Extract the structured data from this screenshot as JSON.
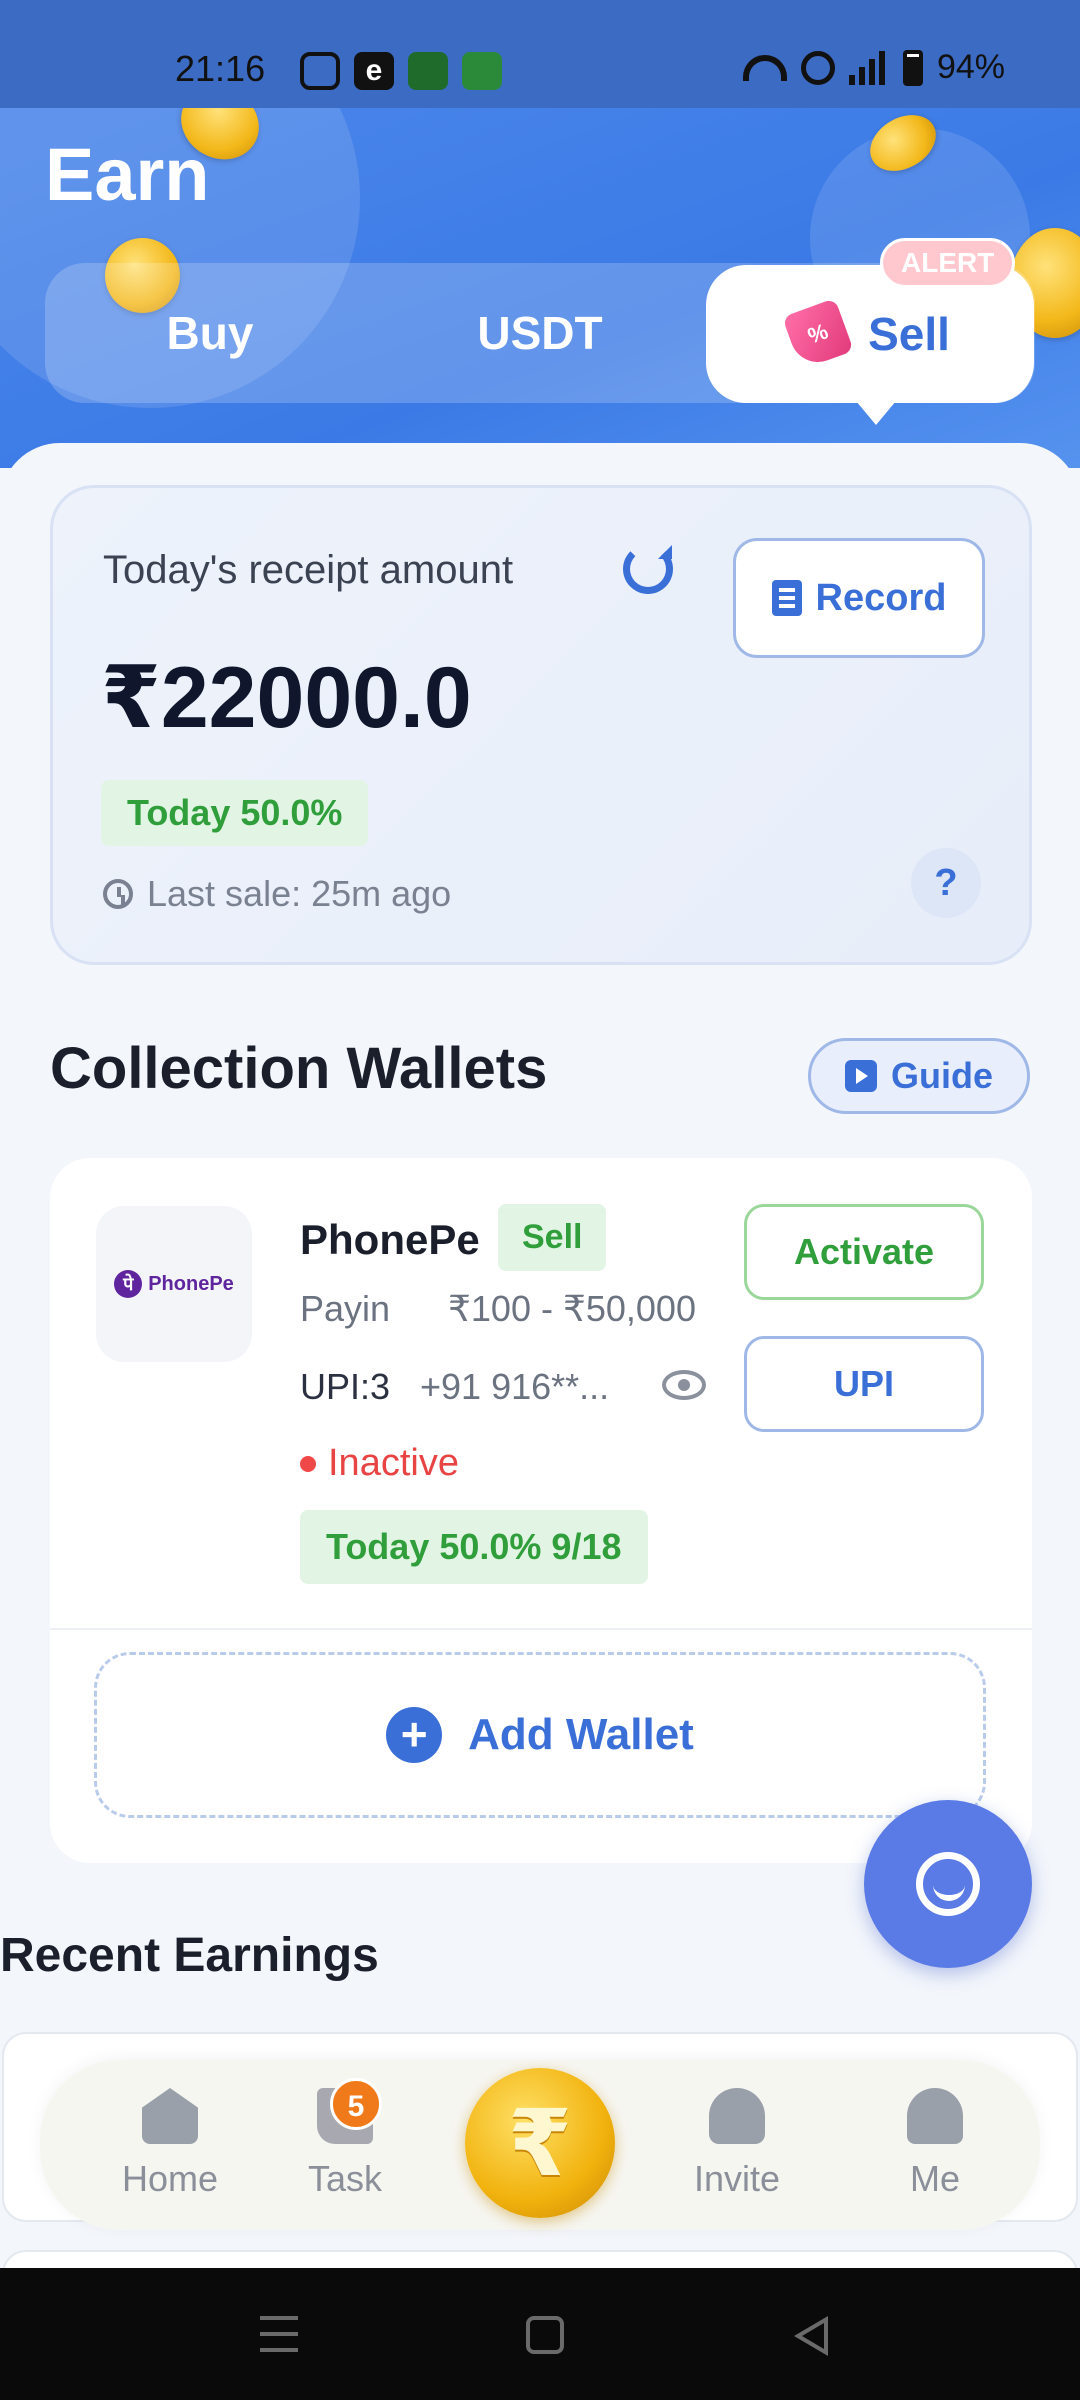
{
  "status_bar": {
    "time": "21:16",
    "battery": "94%",
    "apps": [
      "instagram-icon",
      "e-app-icon",
      "slots-game-icon",
      "casino-game-icon"
    ],
    "icons": [
      "wifi-icon",
      "wifi-call-icon",
      "signal-icon",
      "battery-icon"
    ]
  },
  "header": {
    "title": "Earn",
    "tabs": [
      {
        "label": "Buy"
      },
      {
        "label": "USDT"
      },
      {
        "label": "Sell",
        "active": true,
        "icon": "tag-icon"
      }
    ],
    "alert_badge": "ALERT"
  },
  "receipt": {
    "label": "Today's receipt amount",
    "amount": "₹22000.0",
    "today_rate": "Today 50.0%",
    "last_sale": "Last sale: 25m ago",
    "record_label": "Record",
    "help_label": "?"
  },
  "wallets": {
    "title": "Collection Wallets",
    "guide_label": "Guide",
    "items": [
      {
        "name": "PhonePe",
        "logo_text": "PhonePe",
        "logo_mark": "पे",
        "tag": "Sell",
        "payin_label": "Payin",
        "payin_range": "₹100 - ₹50,000",
        "upi_count": "UPI:3",
        "upi_number": "+91 916**...",
        "status": "Inactive",
        "today_progress": "Today 50.0% 9/18",
        "activate_label": "Activate",
        "upi_label": "UPI"
      }
    ],
    "add_label": "Add Wallet",
    "add_icon": "+"
  },
  "recent": {
    "title": "Recent Earnings"
  },
  "bottom_nav": {
    "items": [
      {
        "label": "Home",
        "icon": "home-icon"
      },
      {
        "label": "Task",
        "icon": "flag-icon",
        "badge": "5"
      },
      {
        "label": "",
        "icon": "rupee-coin-icon",
        "glyph": "₹"
      },
      {
        "label": "Invite",
        "icon": "users-icon"
      },
      {
        "label": "Me",
        "icon": "user-icon"
      }
    ]
  },
  "colors": {
    "accent": "#3b6fd8",
    "header_blue": "#4b86ea",
    "success_green": "#2f9e3b",
    "danger_red": "#e84444",
    "coin_gold": "#f1b20d"
  }
}
